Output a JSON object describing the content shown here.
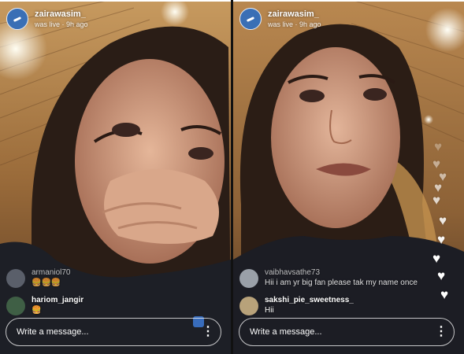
{
  "panels": [
    {
      "username": "zairawasim_",
      "status": "was live · 9h ago",
      "comments": [
        {
          "user": "armaniol70",
          "text": "🍔🍔🍔",
          "dim": true
        },
        {
          "user": "hariom_jangir",
          "text": "🍔",
          "dim": false
        }
      ],
      "message_placeholder": "Write a message...",
      "more_icon": "⋮"
    },
    {
      "username": "zairawasim_",
      "status": "was live · 9h ago",
      "comments": [
        {
          "user": "vaibhavsathe73",
          "text": "Hii i am yr big fan please tak my name once",
          "dim": true
        },
        {
          "user": "sakshi_pie_sweetness_",
          "text": "Hii",
          "dim": false
        }
      ],
      "message_placeholder": "Write a message...",
      "more_icon": "⋮",
      "hearts": [
        "♥",
        "♥",
        "♥",
        "♥",
        "♥",
        "♥",
        "♥",
        "♥",
        "♥",
        "♥"
      ]
    }
  ],
  "colors": {
    "avatar_blue": "#3a6fb5",
    "ceiling": "#b08552",
    "shirt": "#1d1f26"
  },
  "icons": {
    "avatar": "account-avatar-icon",
    "more": "more-options-icon",
    "heart": "heart-icon"
  }
}
